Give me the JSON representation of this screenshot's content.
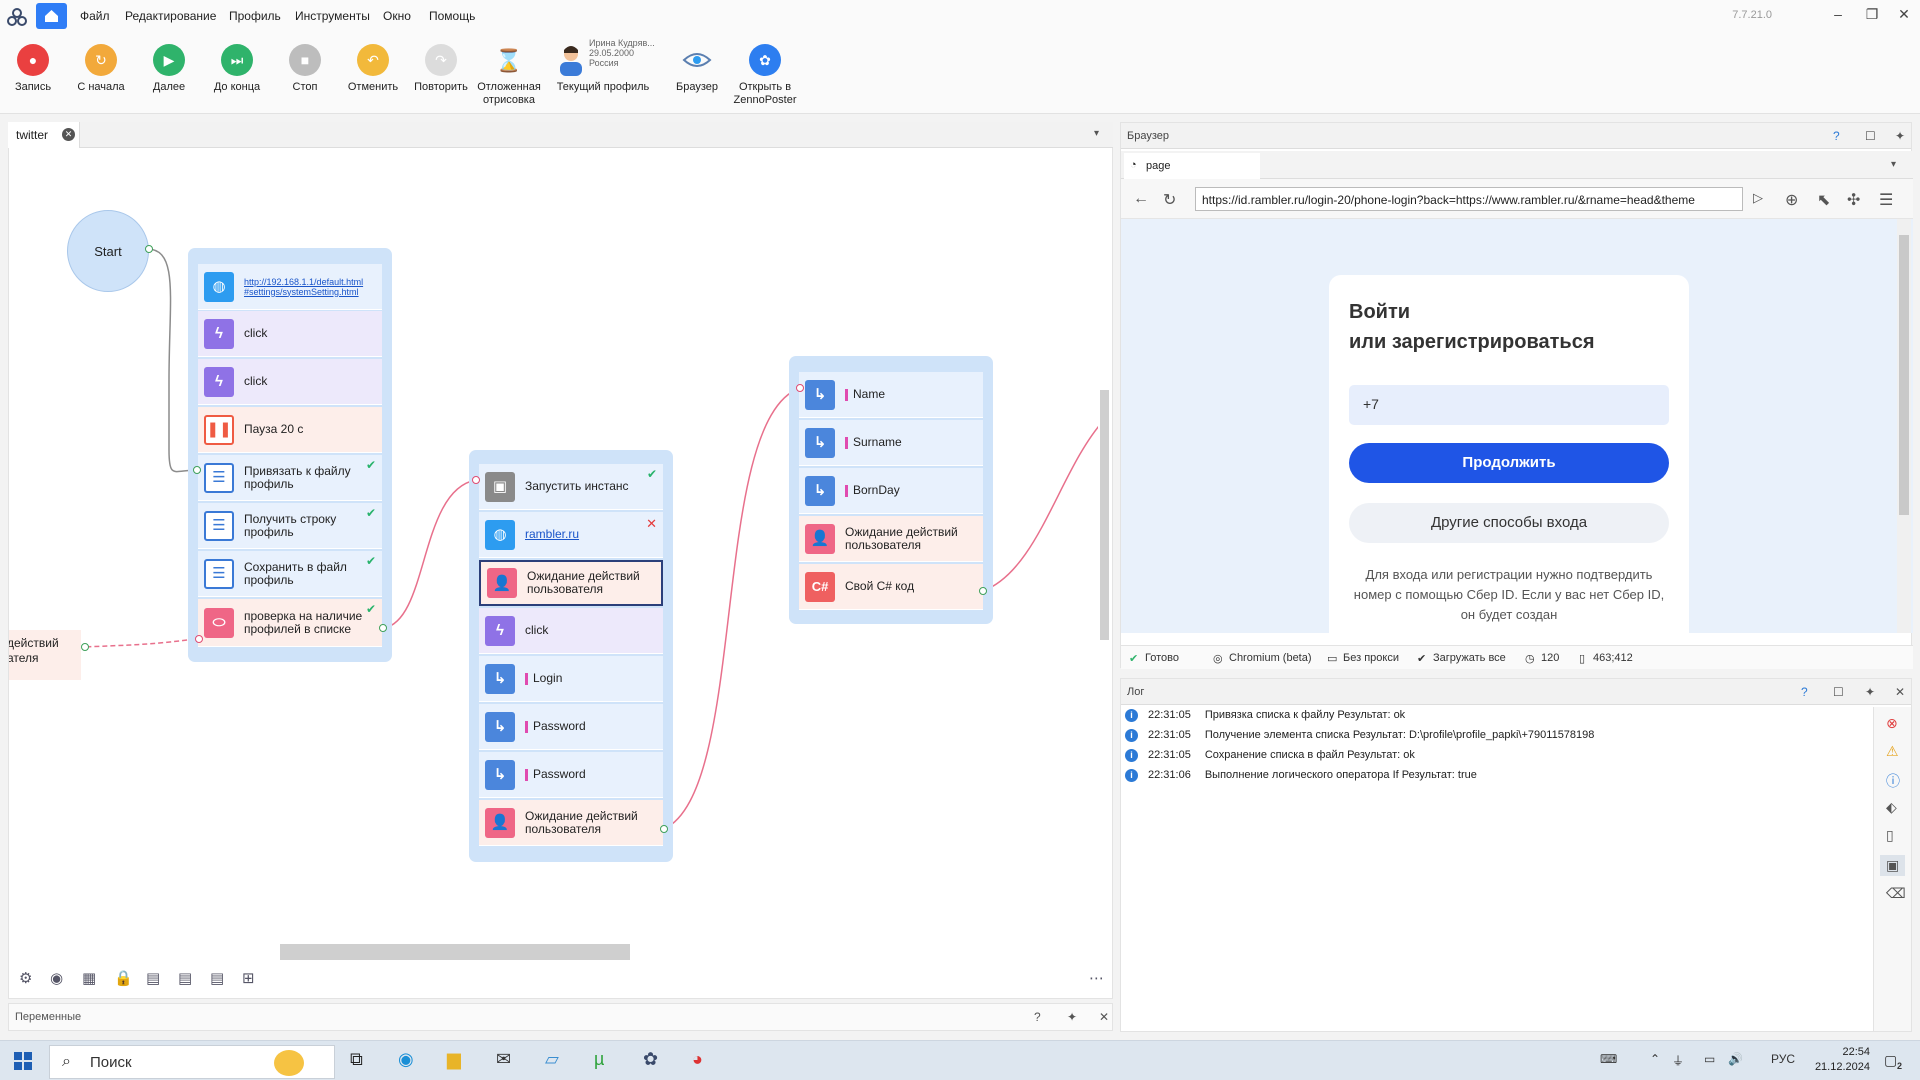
{
  "app": {
    "version": "7.7.21.0",
    "menu": [
      "Файл",
      "Редактирование",
      "Профиль",
      "Инструменты",
      "Окно",
      "Помощь"
    ]
  },
  "toolbar": {
    "record": "Запись",
    "restart": "С начала",
    "next": "Далее",
    "to_end": "До конца",
    "stop": "Стоп",
    "undo": "Отменить",
    "redo": "Повторить",
    "deferred_1": "Отложенная",
    "deferred_2": "отрисовка",
    "current_profile": "Текущий профиль",
    "profile_name": "Ирина Кудряв...",
    "profile_date": "29.05.2000",
    "profile_country": "Россия",
    "browser": "Браузер",
    "open_1": "Открыть в",
    "open_2": "ZennoPoster"
  },
  "project_tab": "twitter",
  "canvas": {
    "start": "Start",
    "group1": [
      {
        "label": "http://192.168.1.1/default.html#settings/systemSetting.html",
        "icon": "globe",
        "kind": "link"
      },
      {
        "label": "click",
        "icon": "lightning"
      },
      {
        "label": "click",
        "icon": "lightning"
      },
      {
        "label": "Пауза 20 с",
        "icon": "pause"
      },
      {
        "label": "Привязать к файлу профиль",
        "icon": "list",
        "check": true
      },
      {
        "label": "Получить строку профиль",
        "icon": "list",
        "check": true
      },
      {
        "label": "Сохранить в файл профиль",
        "icon": "list",
        "check": true
      },
      {
        "label": "проверка на наличие профилей в списке",
        "icon": "if",
        "check": true
      }
    ],
    "group2": [
      {
        "label": "Запустить инстанс",
        "icon": "window",
        "check": true
      },
      {
        "label": "rambler.ru",
        "icon": "globe",
        "kind": "link",
        "error": true
      },
      {
        "label": "Ожидание действий пользователя",
        "icon": "user"
      },
      {
        "label": "click",
        "icon": "lightning"
      },
      {
        "label": "Login",
        "icon": "variable"
      },
      {
        "label": "Password",
        "icon": "variable"
      },
      {
        "label": "Password",
        "icon": "variable"
      },
      {
        "label": "Ожидание действий пользователя",
        "icon": "user"
      }
    ],
    "group3": [
      {
        "label": "Name",
        "icon": "variable"
      },
      {
        "label": "Surname",
        "icon": "variable"
      },
      {
        "label": "BornDay",
        "icon": "variable"
      },
      {
        "label": "Ожидание действий пользователя",
        "icon": "user"
      },
      {
        "label": "Свой C# код",
        "icon": "csharp"
      }
    ],
    "offscreen_node": "действий\nателя"
  },
  "variables_panel": "Переменные",
  "browser": {
    "panel_title": "Браузер",
    "tab": "page",
    "url": "https://id.rambler.ru/login-20/phone-login?back=https://www.rambler.ru/&rname=head&theme",
    "heading": "Войти\nили зарегистрироваться",
    "phone_value": "+7",
    "continue": "Продолжить",
    "other": "Другие способы входа",
    "hint": "Для входа или регистрации нужно подтвердить номер с помощью Сбер ID. Если у вас нет Сбер ID, он будет создан",
    "status": {
      "ready": "Готово",
      "engine": "Chromium (beta)",
      "proxy": "Без прокси",
      "load": "Загружать все",
      "timeout": "120",
      "coords": "463;412"
    }
  },
  "log": {
    "title": "Лог",
    "rows": [
      {
        "time": "22:31:05",
        "text": "Привязка списка к файлу  Результат: ok"
      },
      {
        "time": "22:31:05",
        "text": "Получение элемента списка  Результат: D:\\profile\\profile_papki\\+79011578198"
      },
      {
        "time": "22:31:05",
        "text": "Сохранение списка в файл  Результат: ok"
      },
      {
        "time": "22:31:06",
        "text": "Выполнение логического оператора If  Результат: true"
      }
    ]
  },
  "taskbar": {
    "search": "Поиск",
    "lang": "РУС",
    "time": "22:54",
    "date": "21.12.2024",
    "notifications": "2"
  }
}
